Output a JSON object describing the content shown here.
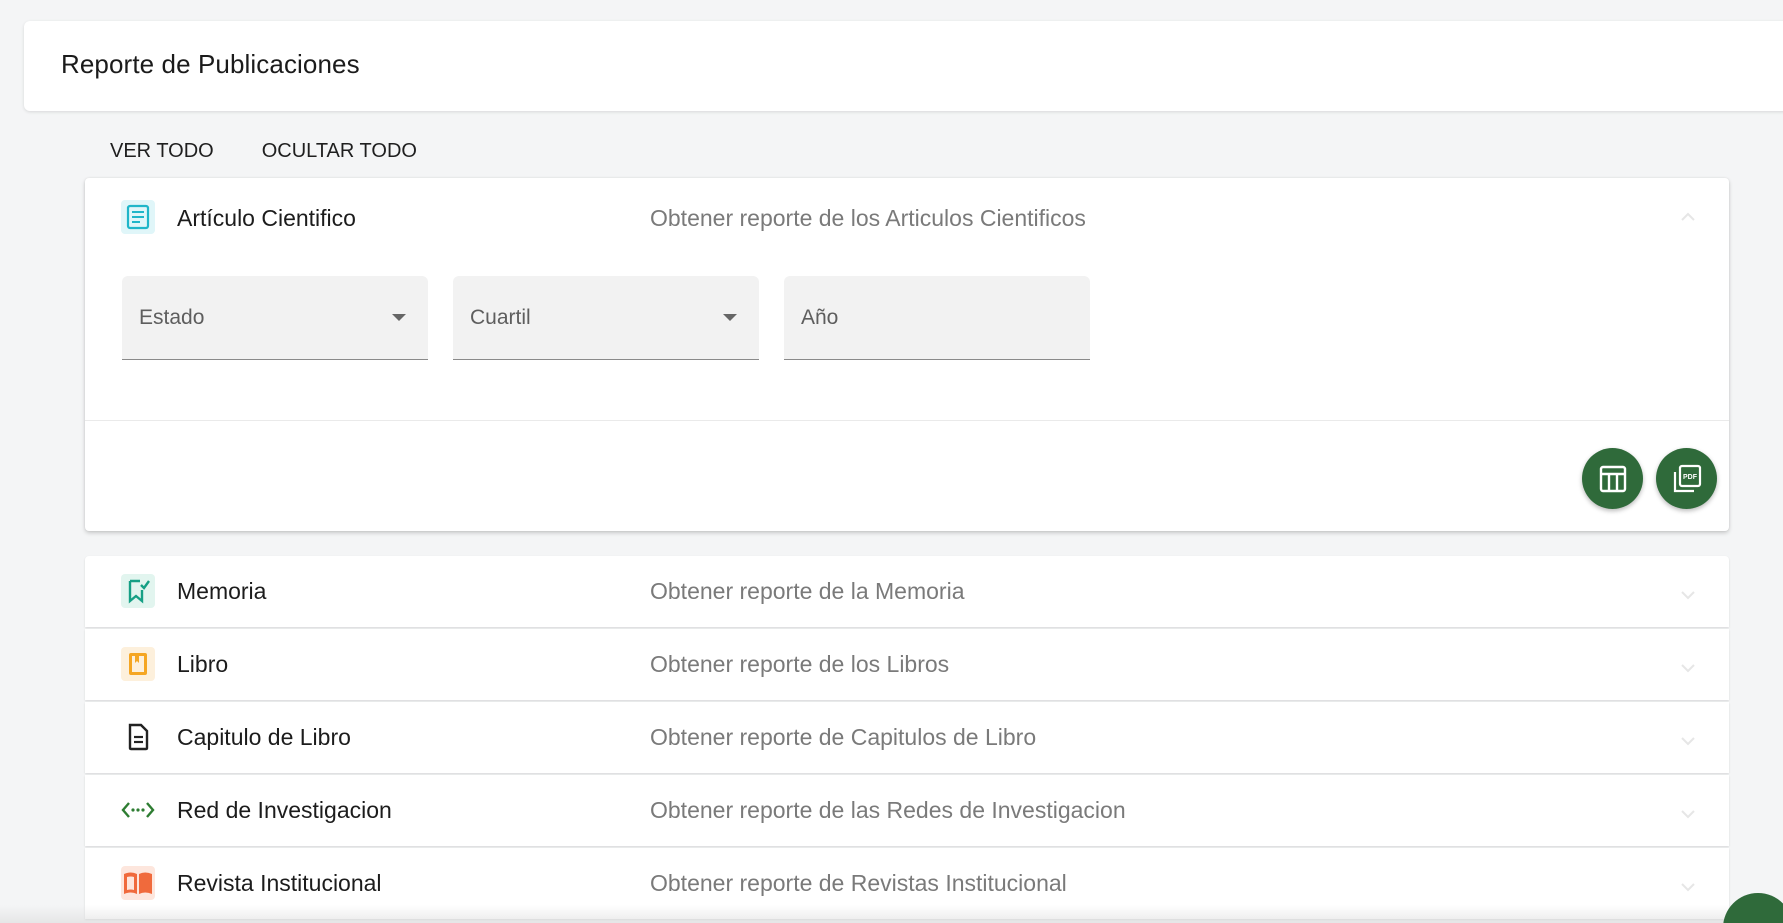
{
  "header": {
    "title": "Reporte de Publicaciones"
  },
  "toolbar": {
    "show_all": "VER TODO",
    "hide_all": "OCULTAR TODO"
  },
  "expanded_panel": {
    "title": "Artículo Cientifico",
    "description": "Obtener reporte de los Articulos Cientificos",
    "icon": "article-icon",
    "icon_color": "#1fb6c9",
    "filters": {
      "estado": "Estado",
      "cuartil": "Cuartil",
      "anio": "Año"
    },
    "actions": {
      "excel_icon": "table-icon",
      "pdf_icon": "pdf-icon",
      "fab_color": "#2f6a3a"
    }
  },
  "panels": [
    {
      "title": "Memoria",
      "description": "Obtener reporte de la Memoria",
      "icon": "bookmark-check-icon",
      "icon_color": "#16a085"
    },
    {
      "title": "Libro",
      "description": "Obtener reporte de los Libros",
      "icon": "book-icon",
      "icon_color": "#f5a623"
    },
    {
      "title": "Capitulo de Libro",
      "description": "Obtener reporte de Capitulos de Libro",
      "icon": "document-icon",
      "icon_color": "#222222"
    },
    {
      "title": "Red de Investigacion",
      "description": "Obtener reporte de las Redes de Investigacion",
      "icon": "network-icon",
      "icon_color": "#2e7d32"
    },
    {
      "title": "Revista Institucional",
      "description": "Obtener reporte de Revistas Institucional",
      "icon": "open-book-icon",
      "icon_color": "#f06a3c"
    }
  ]
}
